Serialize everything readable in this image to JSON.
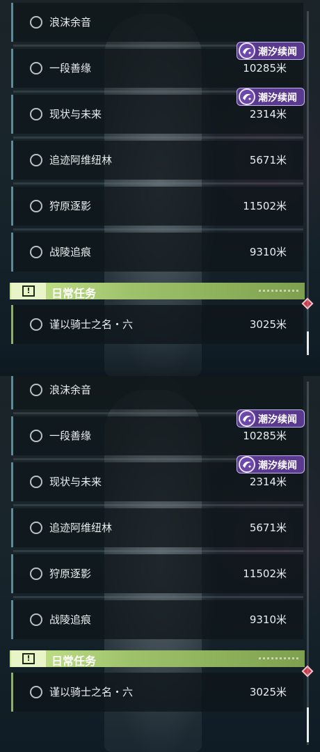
{
  "quests": [
    {
      "name": "浪沫余音",
      "distance": "",
      "tag": ""
    },
    {
      "name": "一段善缘",
      "distance": "10285米",
      "tag": "潮汐续闻"
    },
    {
      "name": "现状与未来",
      "distance": "2314米",
      "tag": "潮汐续闻"
    },
    {
      "name": "追迹阿维纽林",
      "distance": "5671米",
      "tag": ""
    },
    {
      "name": "狩原逐影",
      "distance": "11502米",
      "tag": ""
    },
    {
      "name": "战陵追痕",
      "distance": "9310米",
      "tag": ""
    }
  ],
  "daily": {
    "icon_glyph": "!",
    "title": "日常任务",
    "quest": {
      "name": "谨以骑士之名・六",
      "distance": "3025米"
    }
  },
  "colors": {
    "tag_purple": "#5a3a8e",
    "daily_green": "#9fc36b",
    "alert_red": "#c9364a"
  },
  "icons": [
    "circle-ring-icon",
    "tidal-quest-emblem-icon",
    "exclamation-box-icon",
    "red-diamond-marker-icon"
  ]
}
